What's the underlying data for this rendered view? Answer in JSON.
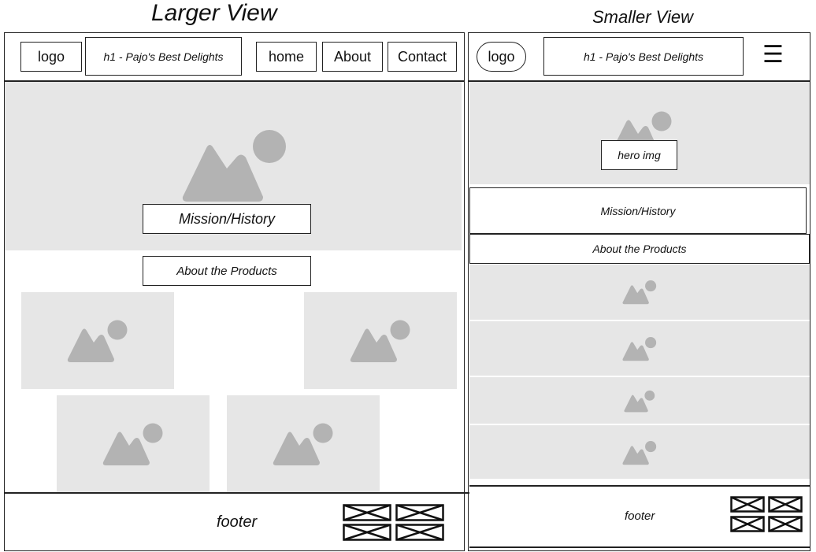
{
  "large": {
    "title": "Larger View",
    "logo": "logo",
    "heading": "h1 - Pajo's Best Delights",
    "nav": [
      "home",
      "About",
      "Contact"
    ],
    "mission": "Mission/History",
    "about_products": "About the Products",
    "footer": "footer"
  },
  "small": {
    "title": "Smaller View",
    "logo": "logo",
    "heading": "h1 - Pajo's Best Delights",
    "menu_icon": "☰",
    "hero": "hero img",
    "mission": "Mission/History",
    "about_products": "About the Products",
    "footer": "footer"
  },
  "icons": {
    "placeholder": "image-placeholder-icon",
    "social": "social-link-placeholder-icon"
  },
  "colors": {
    "placeholder_bg": "#e6e6e6",
    "placeholder_icon": "#b3b3b3",
    "outline": "#222222"
  }
}
